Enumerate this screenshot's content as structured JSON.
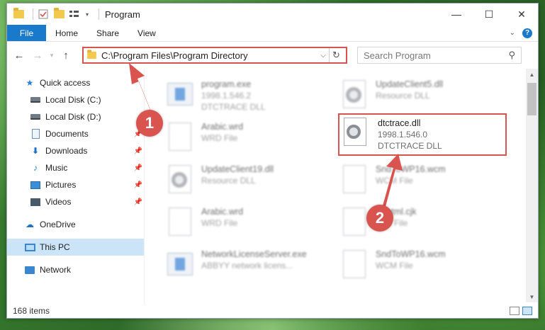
{
  "window": {
    "title": "Program",
    "controls": {
      "minimize": "—",
      "maximize": "☐",
      "close": "✕"
    }
  },
  "ribbon": {
    "tabs": [
      "File",
      "Home",
      "Share",
      "View"
    ],
    "expand_icon": "chevron-down",
    "help_label": "?"
  },
  "address": {
    "path": "C:\\Program Files\\Program Directory",
    "search_placeholder": "Search Program"
  },
  "sidebar": {
    "quick_access": "Quick access",
    "items": [
      {
        "label": "Local Disk (C:)",
        "icon": "drive-icon",
        "pinned": false
      },
      {
        "label": "Local Disk (D:)",
        "icon": "drive-icon",
        "pinned": false
      },
      {
        "label": "Documents",
        "icon": "documents-icon",
        "pinned": true
      },
      {
        "label": "Downloads",
        "icon": "downloads-icon",
        "pinned": true
      },
      {
        "label": "Music",
        "icon": "music-icon",
        "pinned": true
      },
      {
        "label": "Pictures",
        "icon": "pictures-icon",
        "pinned": true
      },
      {
        "label": "Videos",
        "icon": "videos-icon",
        "pinned": true
      }
    ],
    "onedrive": "OneDrive",
    "this_pc": "This PC",
    "network": "Network"
  },
  "files": [
    {
      "name": "program.exe",
      "line2": "1998.1.546.2",
      "line3": "DTCTRACE DLL",
      "icon": "exe"
    },
    {
      "name": "UpdateClient5.dll",
      "line2": "Resource DLL",
      "line3": "",
      "icon": "gear"
    },
    {
      "name": "Arabic.wrd",
      "line2": "WRD File",
      "line3": "",
      "icon": "page"
    },
    {
      "name": "dtctrace.dll",
      "line2": "1998.1.546.0",
      "line3": "DTCTRACE DLL",
      "icon": "gear"
    },
    {
      "name": "UpdateClient19.dll",
      "line2": "Resource DLL",
      "line3": "",
      "icon": "gear"
    },
    {
      "name": "SndToWP16.wcm",
      "line2": "WCM File",
      "line3": "",
      "icon": "page"
    },
    {
      "name": "Arabic.wrd",
      "line2": "WRD File",
      "line3": "",
      "icon": "page"
    },
    {
      "name": "Rkhtml.cjk",
      "line2": "CJK File",
      "line3": "",
      "icon": "page"
    },
    {
      "name": "NetworkLicenseServer.exe",
      "line2": "ABBYY network licens...",
      "line3": "",
      "icon": "exe"
    },
    {
      "name": "SndToWP16.wcm",
      "line2": "WCM File",
      "line3": "",
      "icon": "page"
    }
  ],
  "highlighted": {
    "name": "dtctrace.dll",
    "version": "1998.1.546.0",
    "desc": "DTCTRACE DLL"
  },
  "status": {
    "item_count": "168 items"
  },
  "annotations": {
    "badge1": "1",
    "badge2": "2",
    "color": "#d9534f"
  }
}
